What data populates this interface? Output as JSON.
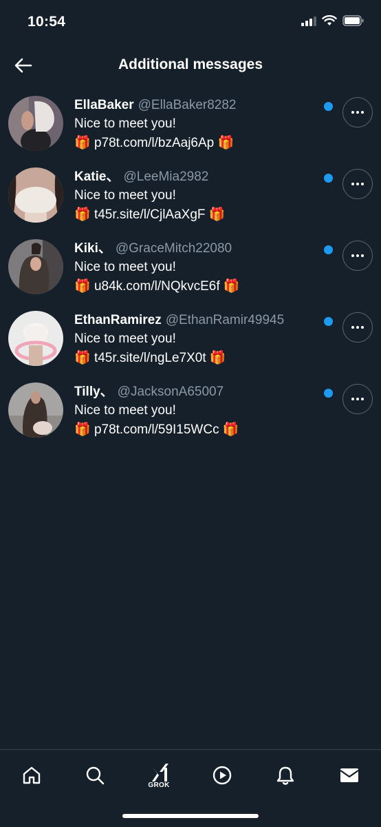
{
  "status_bar": {
    "time": "10:54"
  },
  "header": {
    "title": "Additional messages"
  },
  "messages": [
    {
      "name": "EllaBaker",
      "handle": "@EllaBaker8282",
      "text": "Nice to meet you!",
      "link": "p78t.com/l/bzAaj6Ap",
      "gift_icon": "🎁",
      "unread": true
    },
    {
      "name": "Katie、",
      "handle": "@LeeMia2982",
      "text": "Nice to meet you!",
      "link": "t45r.site/l/CjlAaXgF",
      "gift_icon": "🎁",
      "unread": true
    },
    {
      "name": "Kiki、",
      "handle": "@GraceMitch22080",
      "text": "Nice to meet you!",
      "link": "u84k.com/l/NQkvcE6f",
      "gift_icon": "🎁",
      "unread": true
    },
    {
      "name": "EthanRamirez",
      "handle": "@EthanRamir49945",
      "text": "Nice to meet you!",
      "link": "t45r.site/l/ngLe7X0t",
      "gift_icon": "🎁",
      "unread": true
    },
    {
      "name": "Tilly、",
      "handle": "@JacksonA65007",
      "text": "Nice to meet you!",
      "link": "p78t.com/l/59I15WCc",
      "gift_icon": "🎁",
      "unread": true
    }
  ],
  "bottom_nav": {
    "grok_label": "GROK"
  },
  "colors": {
    "background": "#15202b",
    "accent": "#1d9bf0",
    "secondary_text": "#8b98a5"
  }
}
